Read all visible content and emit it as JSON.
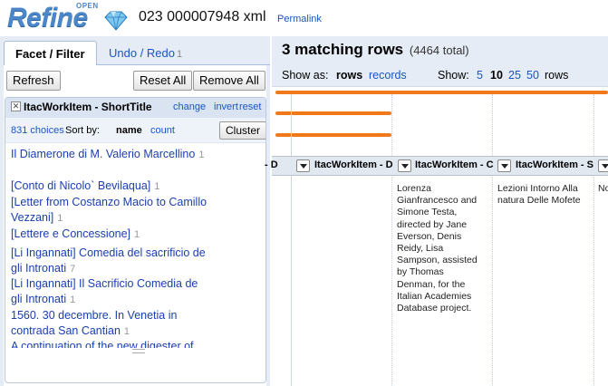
{
  "header": {
    "logo_text": "Refine",
    "logo_open": "OPEN",
    "project_name": "023 000007948 xml",
    "permalink": "Permalink"
  },
  "left": {
    "tabs": [
      {
        "label": "Facet / Filter"
      },
      {
        "label": "Undo / Redo",
        "count": "1"
      }
    ],
    "buttons": {
      "refresh": "Refresh",
      "reset_all": "Reset All",
      "remove_all": "Remove All"
    },
    "facet": {
      "title": "ItacWorkItem - ShortTitle",
      "change": "change",
      "invert": "invert",
      "reset": "reset",
      "choices_count": "831 choices",
      "sort_by": "Sort by:",
      "sort_name": "name",
      "sort_count": "count",
      "cluster": "Cluster",
      "choices": [
        {
          "label": "Il Diamerone di M. Valerio Marcellino",
          "count": "1"
        },
        {
          "label": "[Conto di Nicolo` Bevilaqua]",
          "count": "1"
        },
        {
          "label": "[Letter from Costanzo Macio to Camillo Vezzani]",
          "count": "1"
        },
        {
          "label": "[Lettere e Concessione]",
          "count": "1"
        },
        {
          "label": "[Li Ingannati] Comedia del sacrificio de gli Intronati",
          "count": "7"
        },
        {
          "label": "[Li Ingannati] Il Sacrificio Comedia de gli Intronati",
          "count": "1"
        },
        {
          "label": "1560. 30 decembre. In Venetia in contrada San Cantian",
          "count": "1"
        },
        {
          "label": "A continuation of the new digester of",
          "count": ""
        }
      ]
    }
  },
  "right": {
    "summary_count": "3 matching rows",
    "summary_total": "(4464 total)",
    "show_as": "Show as:",
    "rows": "rows",
    "records": "records",
    "show": "Show:",
    "page_sizes": [
      "5",
      "10",
      "25",
      "50"
    ],
    "selected_page_size": "10",
    "rows_label": "rows",
    "columns": [
      {
        "label": "- D"
      },
      {
        "label": "ItacWorkItem - D"
      },
      {
        "label": "ItacWorkItem - C"
      },
      {
        "label": "ItacWorkItem - S"
      },
      {
        "label": ""
      }
    ],
    "cells": {
      "col3": "Lorenza\nGianfrancesco and\nSimone Testa,\ndirected by Jane\nEverson, Denis\nReidy, Lisa\nSampson, assisted\nby Thomas\nDenman, for the\nItalian Academies\nDatabase project.",
      "col4": "Lezioni Intorno Alla\nnatura Delle Mofete",
      "col5": "No"
    }
  }
}
